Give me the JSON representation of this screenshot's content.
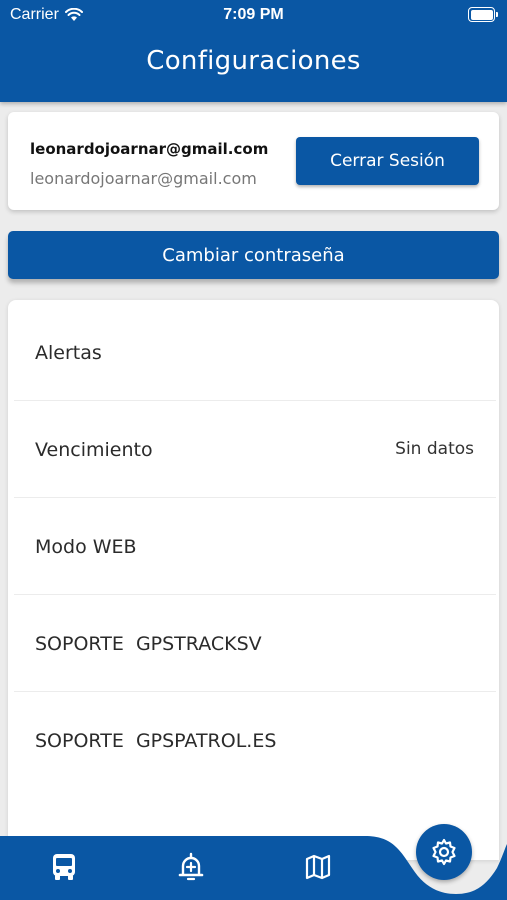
{
  "status_bar": {
    "carrier": "Carrier",
    "time": "7:09 PM"
  },
  "header": {
    "title": "Configuraciones"
  },
  "account": {
    "email_bold": "leonardojoarnar@gmail.com",
    "email": "leonardojoarnar@gmail.com",
    "logout_label": "Cerrar Sesión"
  },
  "change_password_label": "Cambiar contraseña",
  "settings": {
    "items": [
      {
        "label": "Alertas",
        "value": ""
      },
      {
        "label": "Vencimiento",
        "value": "Sin datos"
      },
      {
        "label": "Modo WEB",
        "value": ""
      },
      {
        "label": "SOPORTE  GPSTRACKSV",
        "value": ""
      },
      {
        "label": "SOPORTE  GPSPATROL.ES",
        "value": ""
      }
    ]
  },
  "bottom_nav": {
    "items": [
      "bus-icon",
      "alert-add-icon",
      "map-icon",
      "settings-gear-icon"
    ],
    "active": "settings-gear-icon"
  },
  "colors": {
    "primary": "#0a57a4",
    "background": "#ececec",
    "card": "#ffffff"
  }
}
